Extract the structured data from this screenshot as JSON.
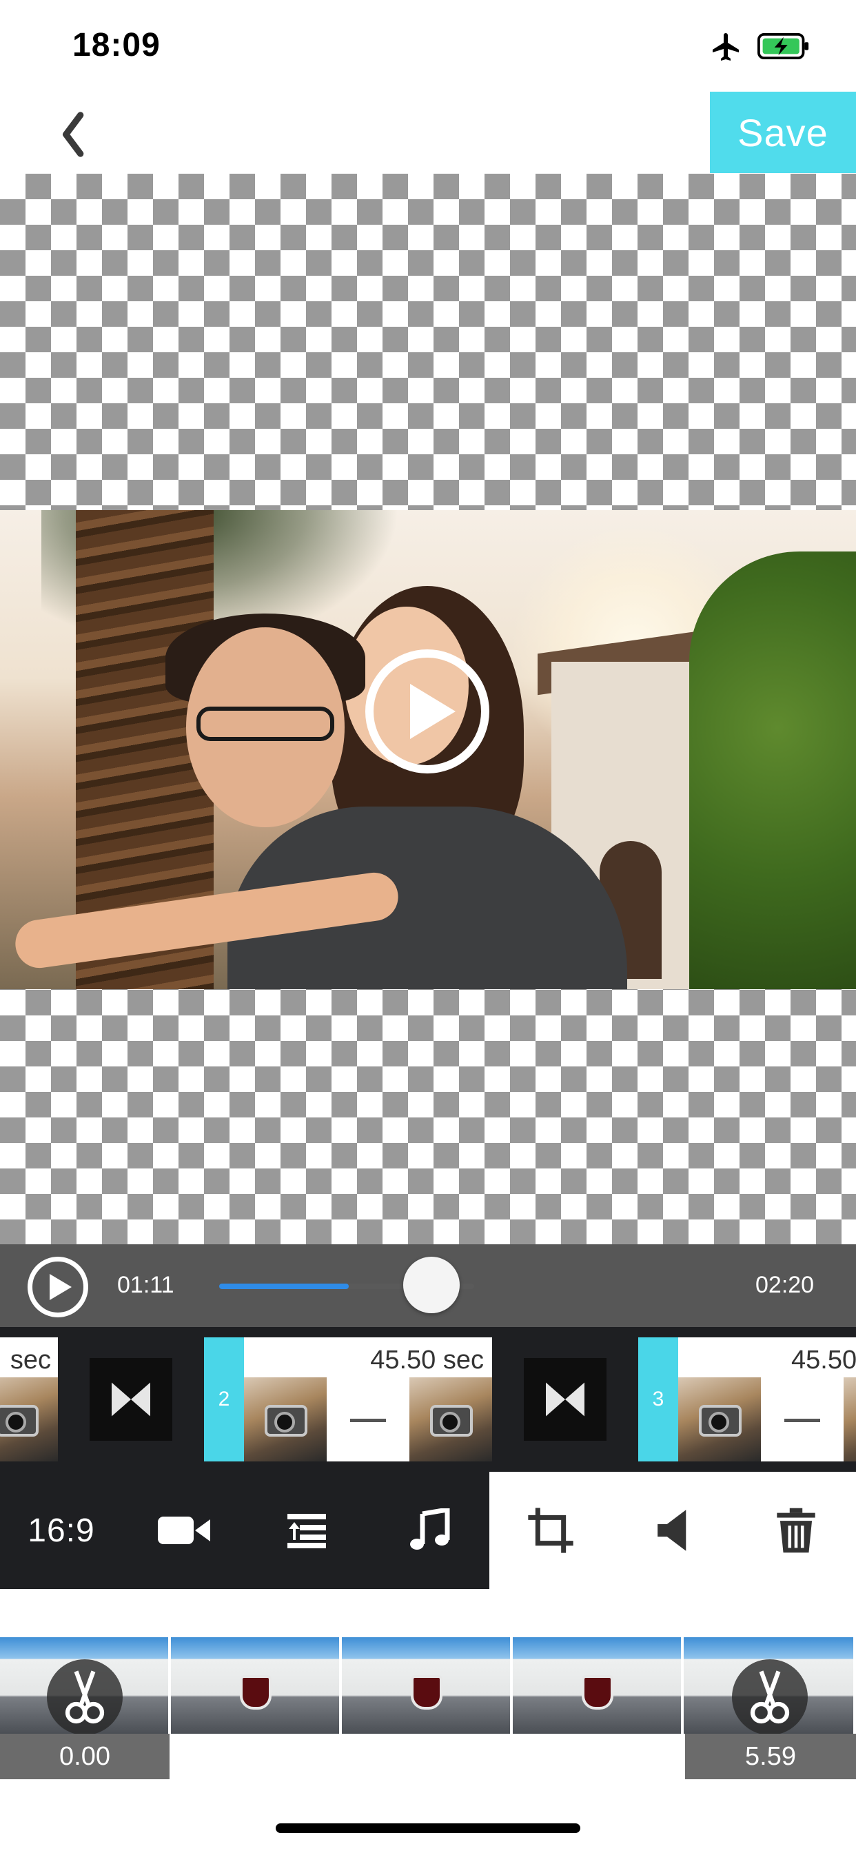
{
  "status_bar": {
    "time": "18:09"
  },
  "nav": {
    "save_label": "Save"
  },
  "player": {
    "current_time": "01:11",
    "total_time": "02:20",
    "progress_fraction": 0.507
  },
  "clips": [
    {
      "duration": "sec"
    },
    {
      "number": "2",
      "duration": "45.50 sec"
    },
    {
      "number": "3",
      "duration": "45.50"
    }
  ],
  "toolbar": {
    "aspect_ratio": "16:9"
  },
  "timeline": {
    "start_label": "0.00",
    "end_label": "5.59"
  },
  "colors": {
    "accent": "#50dcec",
    "dark_panel": "#1e1f22",
    "progress": "#2f8ce8"
  },
  "icons": [
    "airplane-icon",
    "battery-charging-icon",
    "back-chevron-icon",
    "play-icon",
    "transition-icon",
    "video-camera-icon",
    "layers-icon",
    "music-note-icon",
    "crop-icon",
    "speaker-icon",
    "trash-icon",
    "scissors-icon"
  ]
}
